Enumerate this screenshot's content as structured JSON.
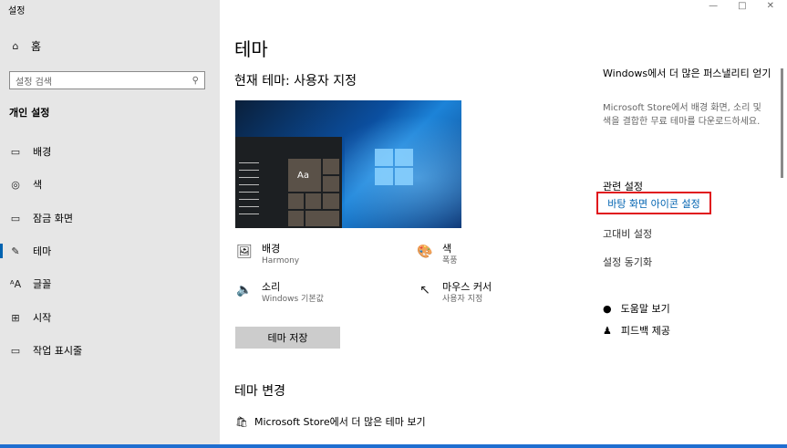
{
  "window": {
    "title": "설정",
    "controls": [
      "—",
      "□",
      "✕"
    ]
  },
  "sidebar": {
    "home": {
      "icon": "home-icon",
      "label": "홈"
    },
    "search": {
      "placeholder": "설정 검색",
      "icon": "search-icon"
    },
    "section": "개인 설정",
    "items": [
      {
        "icon": "background-icon",
        "label": "배경"
      },
      {
        "icon": "palette-icon",
        "label": "색"
      },
      {
        "icon": "lock-screen-icon",
        "label": "잠금 화면"
      },
      {
        "icon": "theme-icon",
        "label": "테마",
        "selected": true
      },
      {
        "icon": "font-icon",
        "label": "글꼴"
      },
      {
        "icon": "start-icon",
        "label": "시작"
      },
      {
        "icon": "taskbar-icon",
        "label": "작업 표시줄"
      }
    ]
  },
  "main": {
    "title": "테마",
    "current_theme": "현재 테마: 사용자 지정",
    "preview_tile_text": "Aa",
    "properties": [
      {
        "icon": "background-icon",
        "label": "배경",
        "value": "Harmony"
      },
      {
        "icon": "palette-icon",
        "label": "색",
        "value": "폭풍"
      },
      {
        "icon": "speaker-icon",
        "label": "소리",
        "value": "Windows 기본값"
      },
      {
        "icon": "cursor-icon",
        "label": "마우스 커서",
        "value": "사용자 지정"
      }
    ],
    "save_button": "테마 저장",
    "change_heading": "테마 변경",
    "store_link": "Microsoft Store에서 더 많은 테마 보기"
  },
  "right": {
    "store_title": "Windows에서 더 많은 퍼스낼리티 얻기",
    "store_desc": "Microsoft Store에서 배경 화면, 소리 및 색을 결합한 무료 테마를 다운로드하세요.",
    "related_heading": "관련 설정",
    "links": [
      "바탕 화면 아이콘 설정",
      "고대비 설정",
      "설정 동기화"
    ],
    "help": "도움말 보기",
    "feedback": "피드백 제공"
  },
  "colors": {
    "accent": "#0063b1",
    "highlight_box": "#e0151c",
    "sidebar_bg": "#e6e6e6"
  }
}
